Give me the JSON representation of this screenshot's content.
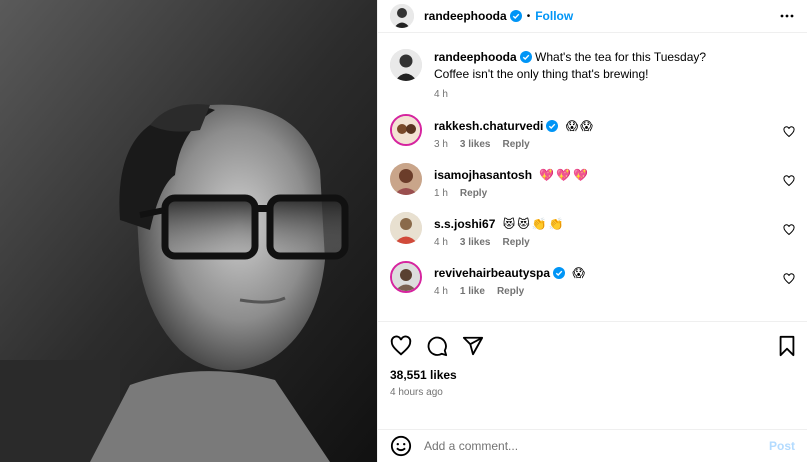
{
  "post_owner": {
    "username": "randeephooda",
    "follow_label": "Follow",
    "separator": "•"
  },
  "caption": {
    "username": "randeephooda",
    "text_line1": "What's the tea for this Tuesday?",
    "text_line2": "Coffee isn't the only thing that's brewing!",
    "time": "4 h"
  },
  "comments": [
    {
      "username": "rakkesh.chaturvedi",
      "verified": true,
      "text": "😱😱",
      "time": "3 h",
      "likes": "3 likes",
      "reply": "Reply"
    },
    {
      "username": "isamojhasantosh",
      "verified": false,
      "text": "💖💖💖",
      "time": "1 h",
      "likes": "",
      "reply": "Reply"
    },
    {
      "username": "s.s.joshi67",
      "verified": false,
      "text": "😻😻👏👏",
      "time": "4 h",
      "likes": "3 likes",
      "reply": "Reply"
    },
    {
      "username": "revivehairbeautyspa",
      "verified": true,
      "text": "😱",
      "time": "4 h",
      "likes": "1 like",
      "reply": "Reply"
    }
  ],
  "stats": {
    "likes": "38,551 likes",
    "posted": "4 hours ago"
  },
  "add_comment": {
    "placeholder": "Add a comment...",
    "post_label": "Post"
  },
  "colors": {
    "accent": "#0095f6",
    "muted": "#737373",
    "post_disabled": "#b3dbff"
  },
  "icons": {
    "like": "heart-icon",
    "comment": "comment-icon",
    "share": "send-icon",
    "save": "bookmark-icon",
    "emoji": "emoji-icon",
    "more": "more-icon",
    "verified": "verified-badge-icon"
  }
}
